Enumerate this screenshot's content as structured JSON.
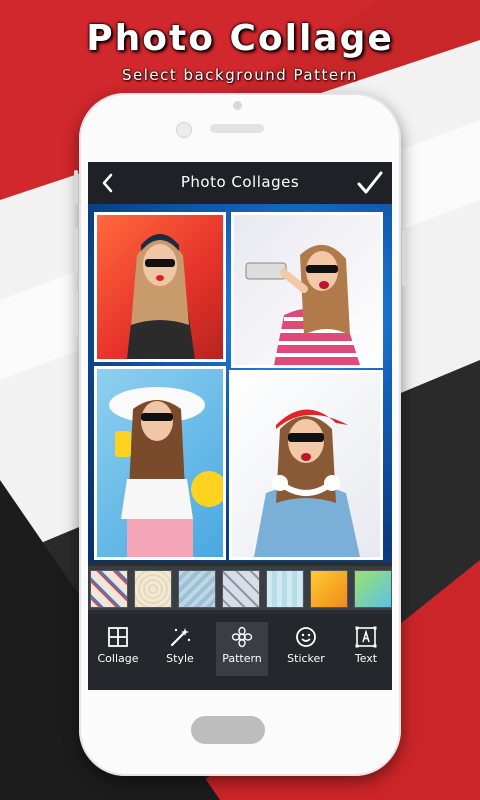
{
  "promo": {
    "title": "Photo Collage",
    "subtitle": "Select background Pattern"
  },
  "app": {
    "title": "Photo Collages"
  },
  "toolbar": {
    "items": [
      {
        "label": "Collage"
      },
      {
        "label": "Style"
      },
      {
        "label": "Pattern"
      },
      {
        "label": "Sticker"
      },
      {
        "label": "Text"
      }
    ]
  },
  "colors": {
    "accent_red": "#cf2b2b",
    "dark": "#242424",
    "topbar": "#1f2126"
  }
}
